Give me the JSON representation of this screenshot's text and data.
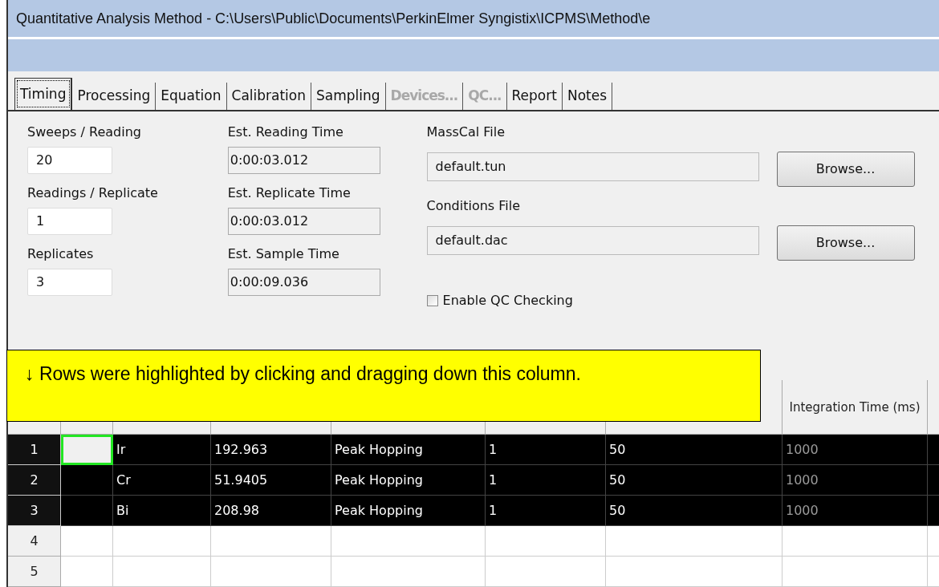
{
  "window": {
    "title": "Quantitative Analysis Method - C:\\Users\\Public\\Documents\\PerkinElmer Syngistix\\ICPMS\\Method\\e"
  },
  "tabs": [
    {
      "label": "Timing",
      "selected": true,
      "disabled": false
    },
    {
      "label": "Processing",
      "selected": false,
      "disabled": false
    },
    {
      "label": "Equation",
      "selected": false,
      "disabled": false
    },
    {
      "label": "Calibration",
      "selected": false,
      "disabled": false
    },
    {
      "label": "Sampling",
      "selected": false,
      "disabled": false
    },
    {
      "label": "Devices...",
      "selected": false,
      "disabled": true
    },
    {
      "label": "QC...",
      "selected": false,
      "disabled": true
    },
    {
      "label": "Report",
      "selected": false,
      "disabled": false
    },
    {
      "label": "Notes",
      "selected": false,
      "disabled": false
    }
  ],
  "timing": {
    "inputs": [
      {
        "label": "Sweeps / Reading",
        "value": "20"
      },
      {
        "label": "Readings / Replicate",
        "value": "1"
      },
      {
        "label": "Replicates",
        "value": "3"
      }
    ],
    "estimates": [
      {
        "label": "Est. Reading Time",
        "value": "0:00:03.012"
      },
      {
        "label": "Est. Replicate Time",
        "value": "0:00:03.012"
      },
      {
        "label": "Est. Sample Time",
        "value": "0:00:09.036"
      }
    ],
    "files": [
      {
        "label": "MassCal File",
        "value": "default.tun",
        "button": "Browse..."
      },
      {
        "label": "Conditions File",
        "value": "default.dac",
        "button": "Browse..."
      }
    ],
    "qc_checkbox": {
      "label": "Enable QC Checking",
      "checked": false
    }
  },
  "callout": {
    "text": "↓ Rows were highlighted by clicking and dragging down this column."
  },
  "table": {
    "last_column_header": "Integration Time (ms)",
    "rows": [
      {
        "number": "1",
        "selected": true,
        "current": true,
        "cells": [
          null,
          {
            "text": "Ir",
            "muted": false
          },
          {
            "text": "192.963",
            "muted": false
          },
          {
            "text": "Peak Hopping",
            "muted": false
          },
          {
            "text": "1",
            "muted": false
          },
          {
            "text": "50",
            "muted": false
          },
          {
            "text": "1000",
            "muted": true
          }
        ]
      },
      {
        "number": "2",
        "selected": true,
        "current": false,
        "cells": [
          null,
          {
            "text": "Cr",
            "muted": false
          },
          {
            "text": "51.9405",
            "muted": false
          },
          {
            "text": "Peak Hopping",
            "muted": false
          },
          {
            "text": "1",
            "muted": false
          },
          {
            "text": "50",
            "muted": false
          },
          {
            "text": "1000",
            "muted": true
          }
        ]
      },
      {
        "number": "3",
        "selected": true,
        "current": false,
        "cells": [
          null,
          {
            "text": "Bi",
            "muted": false
          },
          {
            "text": "208.98",
            "muted": false
          },
          {
            "text": "Peak Hopping",
            "muted": false
          },
          {
            "text": "1",
            "muted": false
          },
          {
            "text": "50",
            "muted": false
          },
          {
            "text": "1000",
            "muted": true
          }
        ]
      },
      {
        "number": "4",
        "selected": false,
        "current": false,
        "cells": [
          null,
          null,
          null,
          null,
          null,
          null,
          null
        ]
      },
      {
        "number": "5",
        "selected": false,
        "current": false,
        "cells": [
          null,
          null,
          null,
          null,
          null,
          null,
          null
        ]
      }
    ]
  }
}
